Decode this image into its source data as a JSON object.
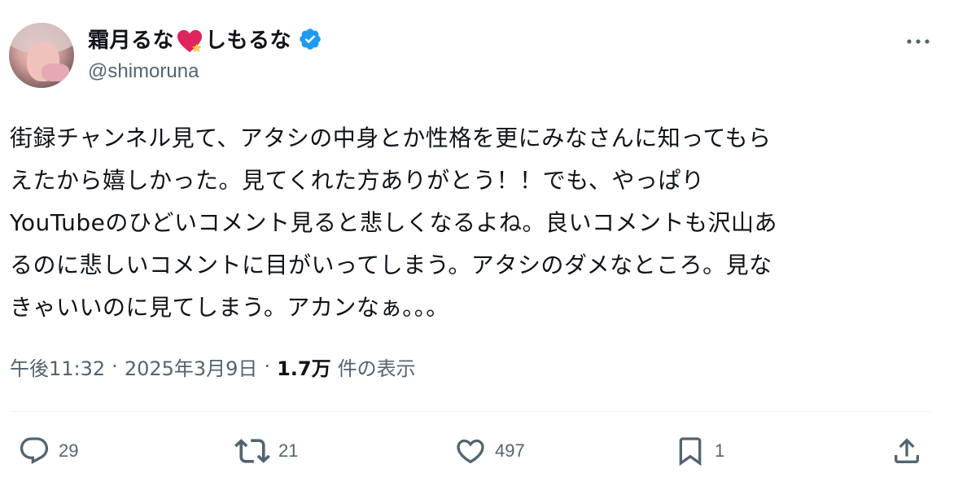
{
  "author": {
    "display_name_part1": "霜月るな",
    "display_name_part2": "しもるな",
    "handle": "@shimoruna"
  },
  "tweet": {
    "text": "街録チャンネル見て、アタシの中身とか性格を更にみなさんに知ってもら\nえたから嬉しかった。見てくれた方ありがとう！！でも、やっぱり\nYouTubeのひどいコメント見ると悲しくなるよね。良いコメントも沢山あ\nるのに悲しいコメントに目がいってしまう。アタシのダメなところ。見な\nきゃいいのに見てしまう。アカンなぁ。。。"
  },
  "meta": {
    "time": "午後11:32",
    "separator": "·",
    "date": "2025年3月9日",
    "views_count": "1.7万",
    "views_label": "件の表示"
  },
  "actions": {
    "replies": "29",
    "reposts": "21",
    "likes": "497",
    "bookmarks": "1"
  },
  "colors": {
    "text": "#0f1419",
    "secondary": "#536471",
    "verified": "#1d9bf0",
    "divider": "#eff3f4"
  },
  "icons": [
    "heart-emoji-icon",
    "verified-badge-icon",
    "more-options-icon",
    "reply-icon",
    "repost-icon",
    "like-icon",
    "bookmark-icon",
    "share-icon"
  ]
}
